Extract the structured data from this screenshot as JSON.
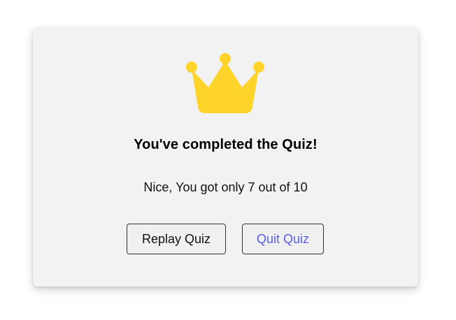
{
  "result": {
    "title": "You've completed the Quiz!",
    "score_text": "Nice, You got only 7 out of 10",
    "icon": "crown-icon"
  },
  "actions": {
    "replay_label": "Replay Quiz",
    "quit_label": "Quit Quiz"
  },
  "colors": {
    "crown": "#ffd42a",
    "quit_text": "#5c5ce0",
    "card_bg": "#f2f2f2"
  }
}
